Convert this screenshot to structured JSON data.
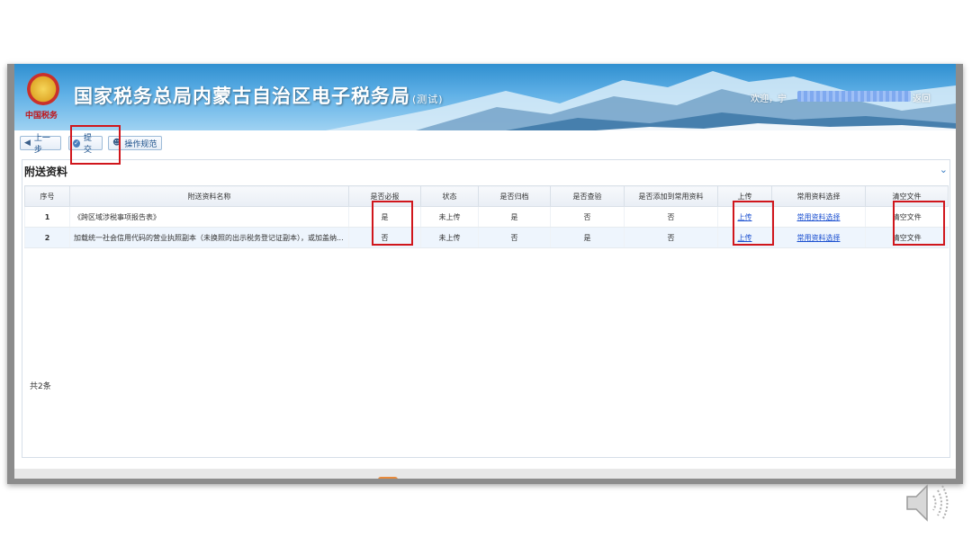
{
  "header": {
    "site_title": "国家税务总局内蒙古自治区电子税务局",
    "test_tag": "(测试)",
    "emblem_text": "中国税务",
    "welcome": "欢迎，宁",
    "back": "返回"
  },
  "toolbar": {
    "prev_label": "上一步",
    "submit_label": "提交",
    "guide_label": "操作规范"
  },
  "panel": {
    "title": "附送资料",
    "collapse_icon": "chevron-down-icon",
    "columns": [
      "序号",
      "附送资料名称",
      "是否必报",
      "状态",
      "是否归档",
      "是否查验",
      "是否添加到常用资料",
      "上传",
      "常用资料选择",
      "清空文件"
    ],
    "rows": [
      {
        "seq": "1",
        "name": "《跨区域涉税事项报告表》",
        "required": "是",
        "status": "未上传",
        "archived": "是",
        "verified": "否",
        "add_common": "否",
        "upload": "上传",
        "common_select": "常用资料选择",
        "clear": "清空文件"
      },
      {
        "seq": "2",
        "name": "加载统一社会信用代码的营业执照副本（未换照的出示税务登记证副本），或加盖纳...",
        "required": "否",
        "status": "未上传",
        "archived": "否",
        "verified": "是",
        "add_common": "否",
        "upload": "上传",
        "common_select": "常用资料选择",
        "clear": "清空文件"
      }
    ],
    "count": "共2条"
  },
  "colors": {
    "highlight": "#d0161c",
    "link": "#1a4fd0",
    "banner": "#2f8fd0"
  }
}
